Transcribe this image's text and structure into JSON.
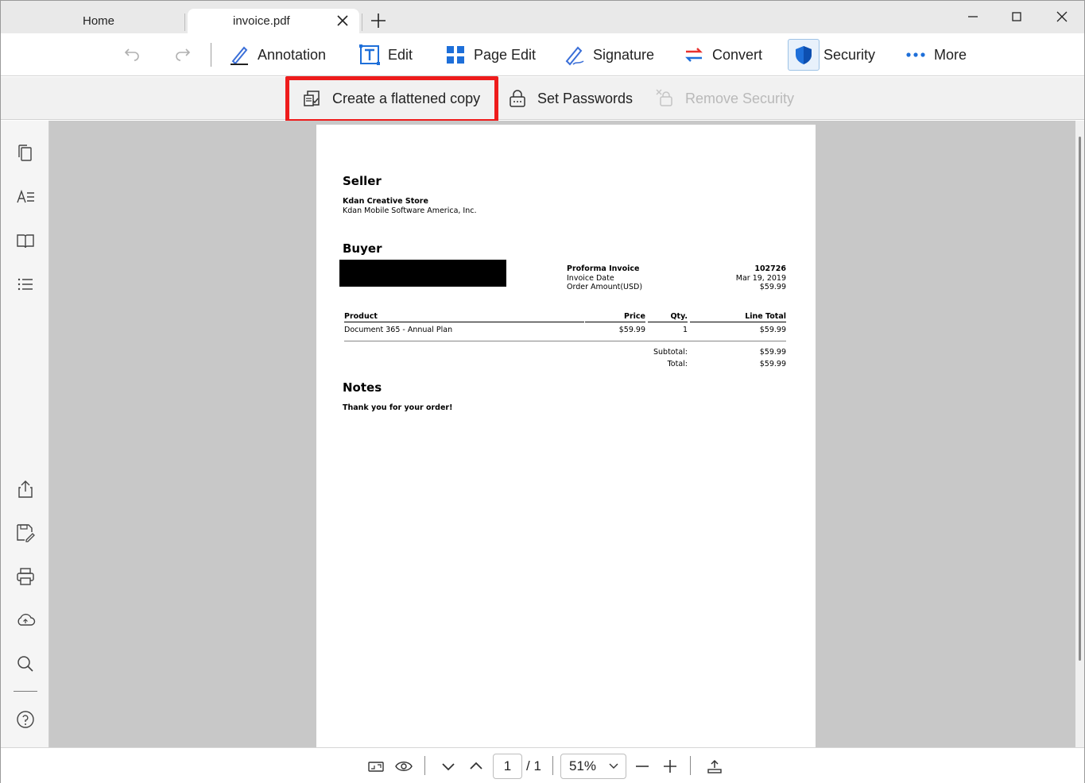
{
  "tabs": {
    "home_label": "Home",
    "active_label": "invoice.pdf"
  },
  "toolbar": {
    "annotation": "Annotation",
    "edit": "Edit",
    "page_edit": "Page Edit",
    "signature": "Signature",
    "convert": "Convert",
    "security": "Security",
    "more": "More",
    "active_item": "Security",
    "accent_color": "#1e6fd9"
  },
  "security_bar": {
    "flatten": "Create a flattened copy",
    "set_passwords": "Set Passwords",
    "remove_security": "Remove Security",
    "highlight_color": "#ee1c1c"
  },
  "left_rail": {
    "top_icons": [
      "pages-icon",
      "text-style-icon",
      "bookmark-book-icon",
      "outline-list-icon"
    ],
    "bottom_icons": [
      "share-icon",
      "save-as-icon",
      "print-icon",
      "cloud-icon",
      "search-icon",
      "help-icon"
    ]
  },
  "document": {
    "seller_heading": "Seller",
    "seller_name": "Kdan Creative Store",
    "seller_company": "Kdan Mobile Software America, Inc.",
    "buyer_heading": "Buyer",
    "invoice_labels": [
      "Proforma Invoice",
      "Invoice Date",
      "Order Amount(USD)"
    ],
    "invoice_values": [
      "102726",
      "Mar 19, 2019",
      "$59.99"
    ],
    "table_headers": {
      "product": "Product",
      "price": "Price",
      "qty": "Qty.",
      "line_total": "Line Total"
    },
    "rows": [
      {
        "product": "Document 365 - Annual Plan",
        "price": "$59.99",
        "qty": "1",
        "line_total": "$59.99"
      }
    ],
    "subtotal_label": "Subtotal:",
    "subtotal_value": "$59.99",
    "total_label": "Total:",
    "total_value": "$59.99",
    "notes_heading": "Notes",
    "notes_text": "Thank you for your order!"
  },
  "bottom_bar": {
    "current_page": "1",
    "total_pages": "/ 1",
    "zoom": "51%"
  }
}
